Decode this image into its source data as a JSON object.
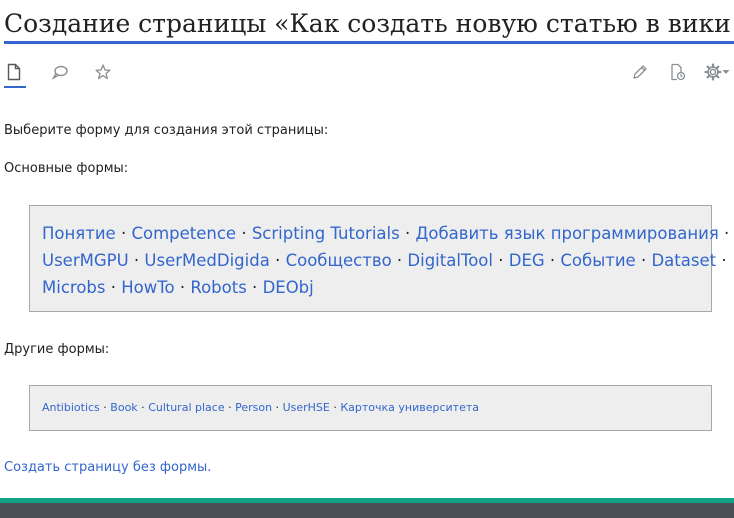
{
  "page": {
    "title": "Создание страницы «Как создать новую статью в вики»"
  },
  "toolbar": {
    "left": [
      {
        "name": "page-icon",
        "label": "Статья"
      },
      {
        "name": "talk-icon",
        "label": "Обсуждение"
      },
      {
        "name": "star-icon",
        "label": "Следить"
      }
    ],
    "right": [
      {
        "name": "pencil-icon",
        "label": "Править"
      },
      {
        "name": "history-icon",
        "label": "История"
      },
      {
        "name": "gear-icon",
        "label": "Ещё"
      }
    ]
  },
  "content": {
    "intro": "Выберите форму для создания этой страницы:",
    "main_heading": "Основные формы:",
    "main_forms_lines": [
      [
        "Понятие",
        "Competence",
        "Scripting Tutorials",
        "Добавить язык программирования"
      ],
      [
        "UserMGPU",
        "UserMedDigida",
        "Сообщество",
        "DigitalTool",
        "DEG",
        "Событие",
        "Dataset"
      ],
      [
        "Microbs",
        "HowTo",
        "Robots",
        "DEObj"
      ]
    ],
    "other_heading": "Другие формы:",
    "other_forms": [
      "Antibiotics",
      "Book",
      "Cultural place",
      "Person",
      "UserHSE",
      "Карточка университета"
    ],
    "separator": " · ",
    "no_form_link": "Создать страницу без формы."
  },
  "colors": {
    "link": "#3366cc",
    "accent": "#3366cc",
    "footer_accent": "#14a085",
    "footer": "#4a4f54",
    "box_bg": "#eeeeee",
    "box_border": "#a2a9b1"
  }
}
